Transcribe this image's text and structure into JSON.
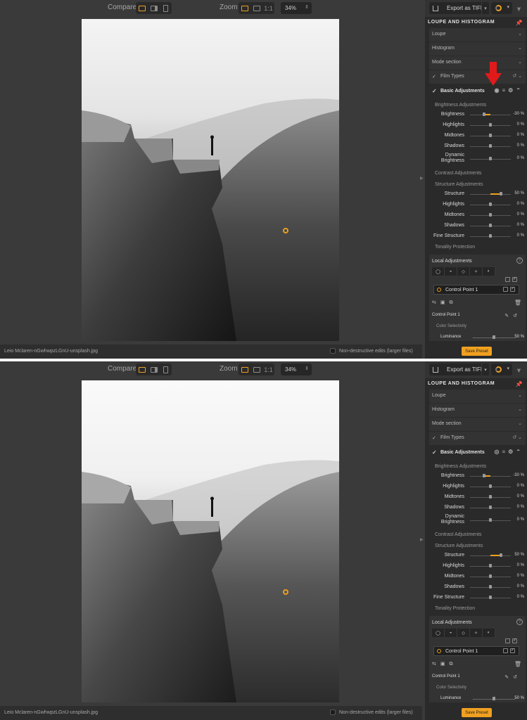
{
  "toolbar": {
    "compare_label": "Compare",
    "zoom_label": "Zoom",
    "one_to_one": "1:1",
    "zoom_value": "34%"
  },
  "status": {
    "filename": "Leio Mclaren-nGwhwpzLGnU-unsplash.jpg",
    "non_destructive_label": "Non-destructive edits (larger files)"
  },
  "sidebar": {
    "export_label": "Export as TIFF",
    "loupe_histogram_title": "LOUPE AND HISTOGRAM",
    "rows": [
      {
        "label": "Loupe"
      },
      {
        "label": "Histogram"
      },
      {
        "label": "Mode section"
      },
      {
        "label": "Film Types"
      }
    ],
    "basic_adjustments": "Basic Adjustments",
    "brightness_adjustments": "Brightness Adjustments",
    "brightness_sliders": [
      {
        "label": "Brightness",
        "value": "-30 %",
        "level": -30
      },
      {
        "label": "Highlights",
        "value": "0 %",
        "level": 0
      },
      {
        "label": "Midtones",
        "value": "0 %",
        "level": 0
      },
      {
        "label": "Shadows",
        "value": "0 %",
        "level": 0
      },
      {
        "label": "Dynamic Brightness",
        "value": "0 %",
        "level": 0
      }
    ],
    "contrast_adjustments": "Contrast Adjustments",
    "structure_adjustments": "Structure Adjustments",
    "structure_sliders": [
      {
        "label": "Structure",
        "value": "50 %",
        "level": 50
      },
      {
        "label": "Highlights",
        "value": "0 %",
        "level": 0
      },
      {
        "label": "Midtones",
        "value": "0 %",
        "level": 0
      },
      {
        "label": "Shadows",
        "value": "0 %",
        "level": 0
      },
      {
        "label": "Fine Structure",
        "value": "0 %",
        "level": 0
      }
    ],
    "tonality_protection": "Tonality Protection",
    "local_adjustments": "Local Adjustments",
    "control_point_item": "Control Point 1",
    "control_point_name": "Control Point 1",
    "color_selectivity": "Color Selectivity",
    "luminance_label": "Luminance",
    "luminance_value": "50 %",
    "save_preset": "Save Preset"
  },
  "colors": {
    "accent": "#f0a020",
    "arrow": "#e01a1a"
  }
}
